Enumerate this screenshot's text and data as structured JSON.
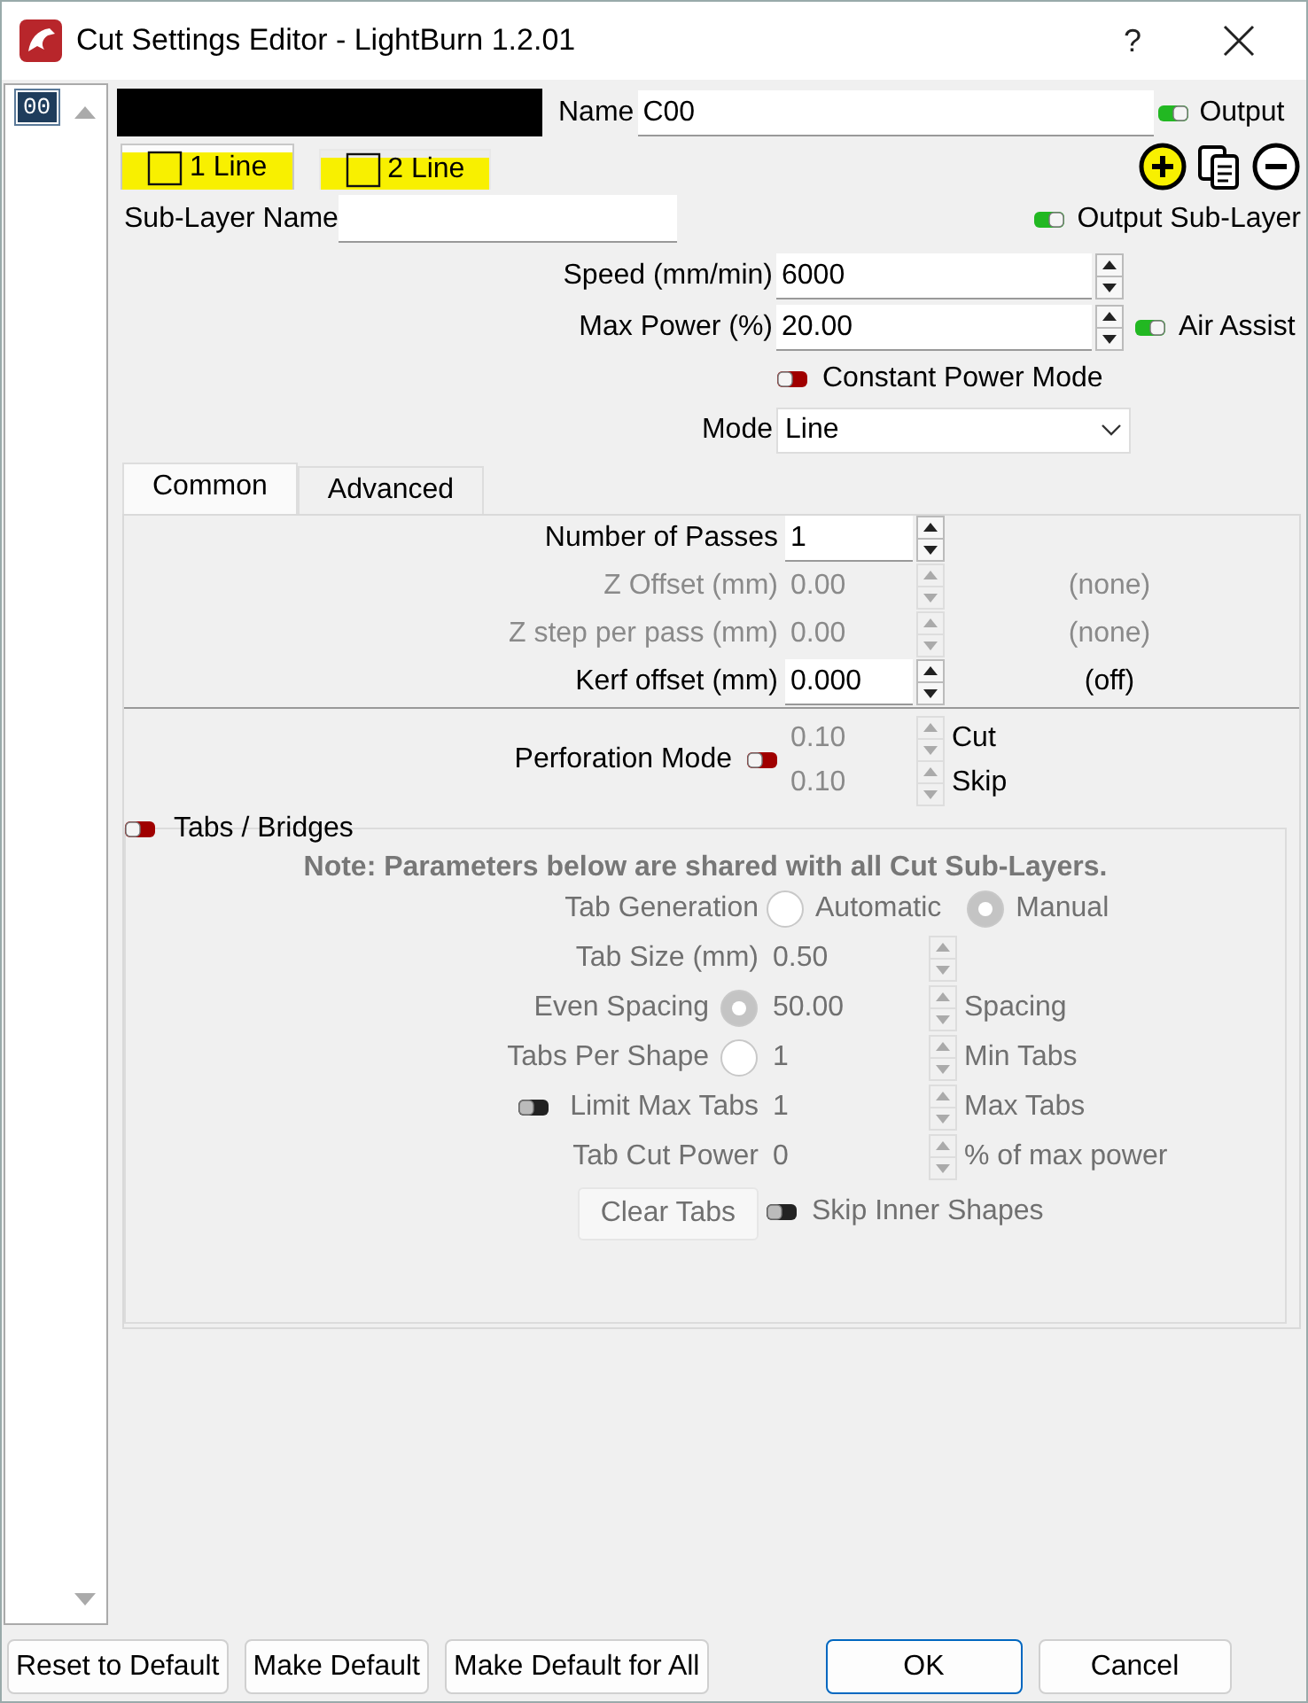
{
  "window": {
    "title": "Cut Settings Editor - LightBurn 1.2.01",
    "help": "?"
  },
  "layer_list": [
    {
      "label": "00",
      "selected": true
    }
  ],
  "layer": {
    "name_label": "Name",
    "name": "C00",
    "output": {
      "label": "Output",
      "on": true
    }
  },
  "sub_layer_tabs": [
    {
      "label": "1 Line",
      "selected": true
    },
    {
      "label": "2 Line",
      "selected": false
    }
  ],
  "sub_layer": {
    "name_label": "Sub-Layer Name",
    "output": {
      "label": "Output Sub-Layer",
      "on": true
    }
  },
  "settings": [
    {
      "label": "Speed (mm/min)",
      "value": "6000"
    },
    {
      "label": "Max Power (%)",
      "value": "20.00",
      "toggle": {
        "label": "Air Assist",
        "on": true
      }
    }
  ],
  "constant_power": {
    "label": "Constant Power Mode",
    "on": false
  },
  "mode": {
    "label": "Mode",
    "value": "Line"
  },
  "tabs": [
    {
      "label": "Common",
      "selected": true
    },
    {
      "label": "Advanced",
      "selected": false
    }
  ],
  "common": {
    "rows": [
      {
        "label": "Number of Passes",
        "value": "1",
        "disabled": false
      },
      {
        "label": "Z Offset (mm)",
        "value": "0.00",
        "disabled": true,
        "note": "(none)"
      },
      {
        "label": "Z step per pass (mm)",
        "value": "0.00",
        "disabled": true,
        "note": "(none)"
      },
      {
        "label": "Kerf offset (mm)",
        "value": "0.000",
        "disabled": false,
        "note": "(off)"
      }
    ]
  },
  "perforation": {
    "label": "Perforation Mode",
    "on": false,
    "values": [
      {
        "value": "0.10",
        "label": "Cut"
      },
      {
        "value": "0.10",
        "label": "Skip"
      }
    ]
  },
  "tabs_bridges": {
    "label": "Tabs / Bridges",
    "on": false,
    "note": "Note: Parameters below are shared with all Cut Sub-Layers.",
    "generation": {
      "label": "Tab Generation",
      "options": [
        {
          "label": "Automatic",
          "selected": false
        },
        {
          "label": "Manual",
          "selected": true
        }
      ]
    },
    "rows": [
      {
        "kind": "plain",
        "label": "Tab Size (mm)",
        "value": "0.50"
      },
      {
        "kind": "radio",
        "label": "Even Spacing",
        "selected": true,
        "value": "50.00",
        "note": "Spacing"
      },
      {
        "kind": "radio",
        "label": "Tabs Per Shape",
        "selected": false,
        "value": "1",
        "note": "Min Tabs"
      },
      {
        "kind": "toggle",
        "label": "Limit Max Tabs",
        "on": false,
        "value": "1",
        "note": "Max Tabs"
      },
      {
        "kind": "plain",
        "label": "Tab Cut Power",
        "value": "0",
        "note": "% of max power"
      }
    ],
    "clear_button": "Clear Tabs",
    "skip_inner": {
      "label": "Skip Inner Shapes",
      "on": false
    }
  },
  "buttons": [
    {
      "label": "Reset to Default",
      "default": false
    },
    {
      "label": "Make Default",
      "default": false
    },
    {
      "label": "Make Default for All",
      "default": false
    },
    {
      "label": "OK",
      "default": true
    },
    {
      "label": "Cancel",
      "default": false
    }
  ]
}
